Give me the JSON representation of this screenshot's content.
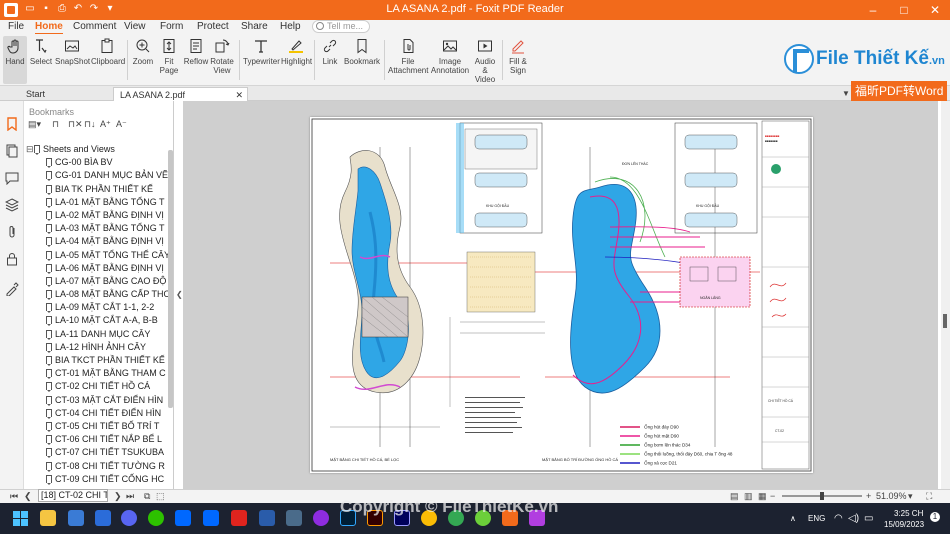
{
  "window": {
    "title": "LA ASANA 2.pdf - Foxit PDF Reader",
    "controls": [
      "–",
      "□",
      "✕"
    ]
  },
  "menu_tabs": [
    "File",
    "Home",
    "Comment",
    "View",
    "Form",
    "Protect",
    "Share",
    "Help"
  ],
  "active_menu_tab": "Home",
  "tell_me": {
    "placeholder": "Tell me..."
  },
  "ribbon": {
    "buttons": [
      {
        "label": "Hand",
        "icon": "hand-icon"
      },
      {
        "label": "Select",
        "icon": "text-cursor-icon"
      },
      {
        "label": "SnapShot",
        "icon": "camera-icon"
      },
      {
        "label": "Clipboard",
        "icon": "clipboard-icon"
      },
      {
        "label": "Zoom",
        "icon": "zoom-icon"
      },
      {
        "label": "Fit\nPage",
        "icon": "fit-page-icon"
      },
      {
        "label": "Reflow",
        "icon": "reflow-icon"
      },
      {
        "label": "Rotate\nView",
        "icon": "rotate-icon"
      },
      {
        "label": "Typewriter",
        "icon": "typewriter-icon"
      },
      {
        "label": "Highlight",
        "icon": "highlight-icon"
      },
      {
        "label": "Link",
        "icon": "link-icon"
      },
      {
        "label": "Bookmark",
        "icon": "bookmark-icon"
      },
      {
        "label": "File\nAttachment",
        "icon": "attachment-icon"
      },
      {
        "label": "Image\nAnnotation",
        "icon": "image-icon"
      },
      {
        "label": "Audio\n& Video",
        "icon": "media-icon"
      },
      {
        "label": "Fill &\nSign",
        "icon": "sign-icon"
      }
    ]
  },
  "logo": {
    "text": "File Thiết Kế",
    "suffix": ".vn"
  },
  "doc_tabs": [
    {
      "label": "Start"
    },
    {
      "label": "LA ASANA 2.pdf"
    }
  ],
  "convert_banner": "福昕PDF转Word",
  "bookmarks": {
    "panel_title": "Bookmarks",
    "root": "Sheets and Views",
    "items": [
      "CG-00 BÌA BV",
      "CG-01 DANH MỤC BẢN VẼ",
      "BIA TK PHẦN THIẾT KẾ",
      "LA-01 MẶT BẰNG TỔNG T",
      "LA-02 MẶT BẰNG ĐỊNH VỊ",
      "LA-03 MẶT BẰNG TỔNG T",
      "LA-04 MẶT BẰNG ĐỊNH VỊ",
      "LA-05 MẶT TỔNG THỂ CÂY",
      "LA-06 MẶT BẰNG ĐỊNH VỊ",
      "LA-07 MẶT BẰNG CAO ĐỘ",
      "LA-08 MẶT BẰNG CẤP THO",
      "LA-09 MẶT CẮT 1-1, 2-2",
      "LA-10 MẶT CẮT A-A, B-B",
      "LA-11 DANH MỤC CÂY",
      "LA-12 HÌNH ẢNH CÂY",
      "BIA TKCT PHẦN THIẾT KẾ",
      "CT-01 MẶT BẰNG THAM C",
      "CT-02 CHI TIẾT HỒ CÁ",
      "CT-03 MẶT CẮT ĐIỂN HÌN",
      "CT-04 CHI TIẾT ĐIỂN HÌN",
      "CT-05 CHI TIẾT BỐ TRÍ T",
      "CT-06 CHI TIẾT NẮP BỂ L",
      "CT-07 CHI TIẾT TSUKUBA",
      "CT-08 CHI TIẾT TƯỜNG R",
      "CT-09 CHI TIẾT CỐNG HC"
    ]
  },
  "drawing": {
    "labels": {
      "left_plan": "MẶT BẰNG CHI TIẾT HỒ CÁ, BỂ LỌC",
      "right_plan": "MẶT BẰNG BỐ TRÍ ĐƯỜNG ỐNG HỒ CÁ",
      "wash_area_1": "KHU GỘI ĐẦU",
      "wash_area_2": "KHU GỘI ĐẦU",
      "waterfall": "ĐƠN LÊN THÁC",
      "pump_room": "NGĂN LẮNG",
      "sheet_title": "CHI TIẾT HỒ CÁ",
      "sheet_no": "CT-02"
    },
    "legend": [
      {
        "label": "Ống hút đáy D90",
        "color": "#d81b60"
      },
      {
        "label": "Ống hút mặt D90",
        "color": "#e91e8c"
      },
      {
        "label": "Ống bơm lên thác D34",
        "color": "#2ca02c"
      },
      {
        "label": "Ống thổi luồng, thổi đáy D60, chia T ống 48",
        "color": "#7cd957"
      },
      {
        "label": "Ống xả cọc D21",
        "color": "#1f1fbf"
      }
    ]
  },
  "status": {
    "page_field": "[18]  CT-02 CHI T",
    "zoom": "51.09%"
  },
  "taskbar": {
    "lang": "ENG",
    "time": "3:25 CH",
    "date": "15/09/2023"
  },
  "watermark": "Copyright © FileThietKe.vn"
}
